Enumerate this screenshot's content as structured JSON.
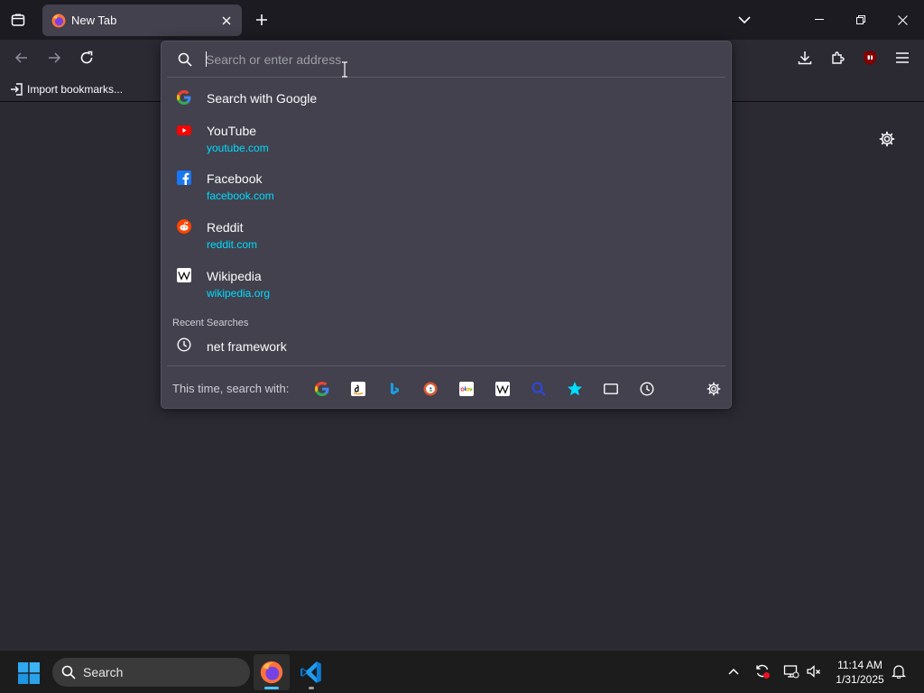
{
  "colors": {
    "tabstrip_bg": "#1c1b22",
    "toolbar_bg": "#2b2a33",
    "popup_bg": "#42414d",
    "url_color": "#00ddff",
    "taskbar_bg": "#1c1c1c"
  },
  "tab": {
    "title": "New Tab",
    "favicon": "firefox-icon"
  },
  "bookmarks": {
    "import_label": "Import bookmarks..."
  },
  "urlbar": {
    "placeholder": "Search or enter address",
    "value": ""
  },
  "results": [
    {
      "title": "Search with Google",
      "url": "",
      "icon": "google-icon"
    },
    {
      "title": "YouTube",
      "url": "youtube.com",
      "icon": "youtube-icon"
    },
    {
      "title": "Facebook",
      "url": "facebook.com",
      "icon": "facebook-icon"
    },
    {
      "title": "Reddit",
      "url": "reddit.com",
      "icon": "reddit-icon"
    },
    {
      "title": "Wikipedia",
      "url": "wikipedia.org",
      "icon": "wikipedia-icon"
    }
  ],
  "recent": {
    "label": "Recent Searches",
    "items": [
      {
        "title": "net framework",
        "icon": "history-icon"
      }
    ]
  },
  "oneoffs": {
    "label": "This time, search with:",
    "engines": [
      "google",
      "amazon",
      "bing",
      "duckduckgo",
      "ebay",
      "wikipedia",
      "search",
      "bookmarks",
      "tabs",
      "history"
    ]
  },
  "taskbar": {
    "search_label": "Search",
    "time": "11:14 AM",
    "date": "1/31/2025"
  }
}
